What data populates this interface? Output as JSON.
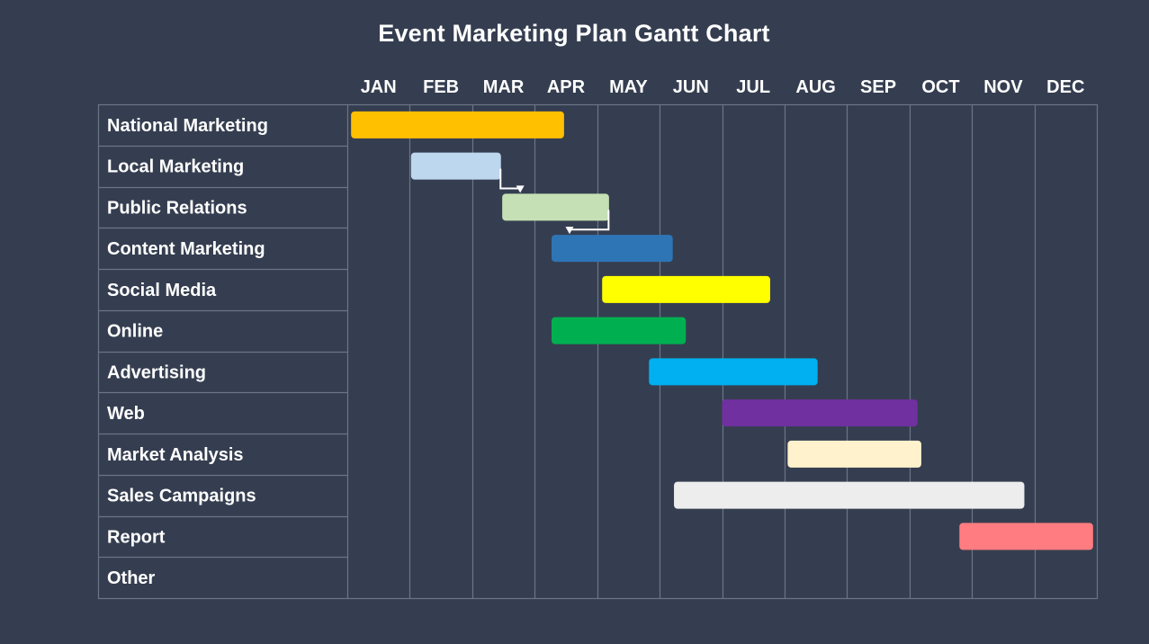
{
  "chart_data": {
    "type": "gantt",
    "title": "Event Marketing Plan Gantt Chart",
    "months": [
      "JAN",
      "FEB",
      "MAR",
      "APR",
      "MAY",
      "JUN",
      "JUL",
      "AUG",
      "SEP",
      "OCT",
      "NOV",
      "DEC"
    ],
    "time_unit": "month index (0 = start of JAN, 12 = end of DEC)",
    "xlim": [
      0,
      12
    ],
    "grid": true,
    "tasks": [
      {
        "name": "National Marketing",
        "start": 0.06,
        "end": 3.47,
        "color": "#ffc000"
      },
      {
        "name": "Local Marketing",
        "start": 1.02,
        "end": 2.46,
        "color": "#bdd7ee"
      },
      {
        "name": "Public Relations",
        "start": 2.48,
        "end": 4.19,
        "color": "#c5e0b4"
      },
      {
        "name": "Content Marketing",
        "start": 3.27,
        "end": 5.21,
        "color": "#2e75b6"
      },
      {
        "name": "Social Media",
        "start": 4.08,
        "end": 6.77,
        "color": "#ffff00"
      },
      {
        "name": "Online",
        "start": 3.27,
        "end": 5.42,
        "color": "#00b050"
      },
      {
        "name": "Advertising",
        "start": 4.83,
        "end": 7.53,
        "color": "#00b0f0"
      },
      {
        "name": "Web",
        "start": 6.0,
        "end": 9.13,
        "color": "#7030a0"
      },
      {
        "name": "Market Analysis",
        "start": 7.05,
        "end": 9.19,
        "color": "#fff2cc"
      },
      {
        "name": "Sales Campaigns",
        "start": 5.23,
        "end": 10.84,
        "color": "#ededed"
      },
      {
        "name": "Report",
        "start": 9.8,
        "end": 11.94,
        "color": "#ff7c80"
      },
      {
        "name": "Other",
        "start": null,
        "end": null,
        "color": null
      }
    ],
    "dependencies": [
      {
        "from": "Local Marketing",
        "to": "Public Relations"
      },
      {
        "from": "Public Relations",
        "to": "Content Marketing"
      }
    ]
  },
  "colors": {
    "background": "#353e50",
    "grid": "#6b7586",
    "text": "#ffffff",
    "connector": "#ffffff"
  }
}
